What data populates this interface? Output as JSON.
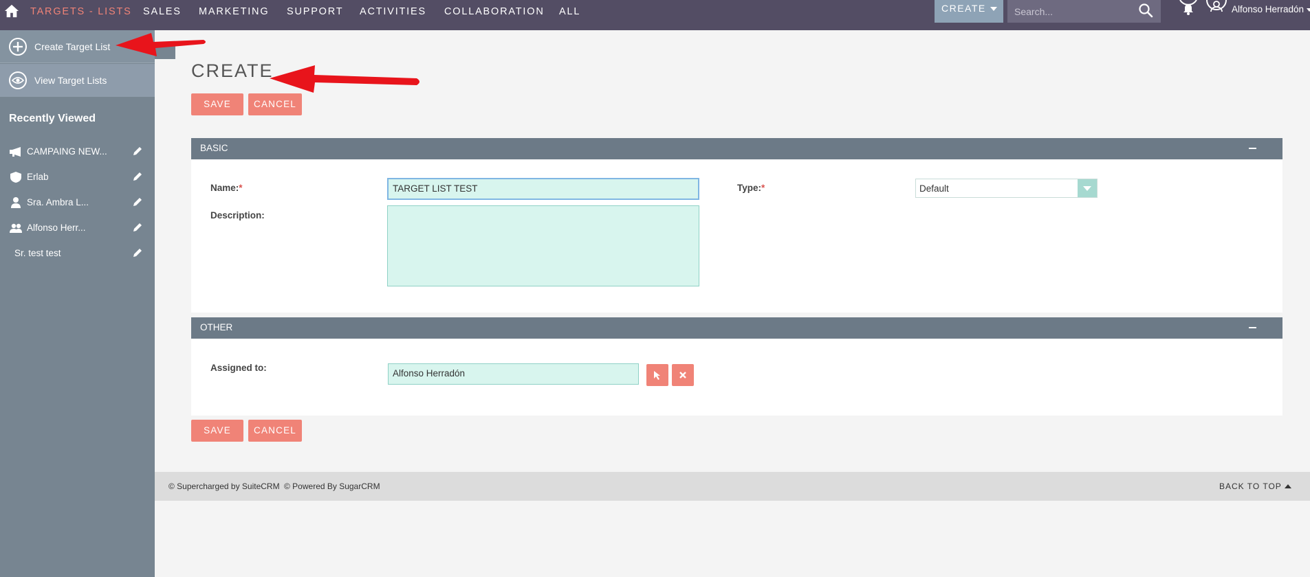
{
  "nav": {
    "items": [
      "TARGETS - LISTS",
      "SALES",
      "MARKETING",
      "SUPPORT",
      "ACTIVITIES",
      "COLLABORATION",
      "ALL"
    ],
    "create_label": "CREATE",
    "search_placeholder": "Search...",
    "user_name": "Alfonso Herradón"
  },
  "sidebar": {
    "actions": [
      "Create Target List",
      "View Target Lists"
    ],
    "recently_viewed_title": "Recently Viewed",
    "recent_items": [
      {
        "label": "CAMPAING NEW...",
        "icon": "megaphone-icon"
      },
      {
        "label": "Erlab",
        "icon": "shield-icon"
      },
      {
        "label": "Sra. Ambra L...",
        "icon": "person-icon"
      },
      {
        "label": "Alfonso Herr...",
        "icon": "users-icon"
      },
      {
        "label": "Sr. test test",
        "icon": ""
      }
    ]
  },
  "main": {
    "title": "CREATE",
    "save_label": "SAVE",
    "cancel_label": "CANCEL",
    "basic": {
      "header": "BASIC",
      "name_label": "Name:",
      "name_value": "TARGET LIST TEST",
      "description_label": "Description:",
      "description_value": "",
      "type_label": "Type:",
      "type_value": "Default"
    },
    "other": {
      "header": "OTHER",
      "assigned_label": "Assigned to:",
      "assigned_value": "Alfonso Herradón"
    },
    "required_mark": "*"
  },
  "footer": {
    "supercharged": "© Supercharged by SuiteCRM",
    "powered": "© Powered By SugarCRM",
    "back_to_top": "BACK TO TOP"
  },
  "colors": {
    "nav_bg": "#534d64",
    "accent": "#f08377",
    "sidebar_bg": "#778591",
    "panel_header": "#6c7a87",
    "field_bg": "#d8f5ee",
    "annotation_arrow": "#e8141b"
  }
}
